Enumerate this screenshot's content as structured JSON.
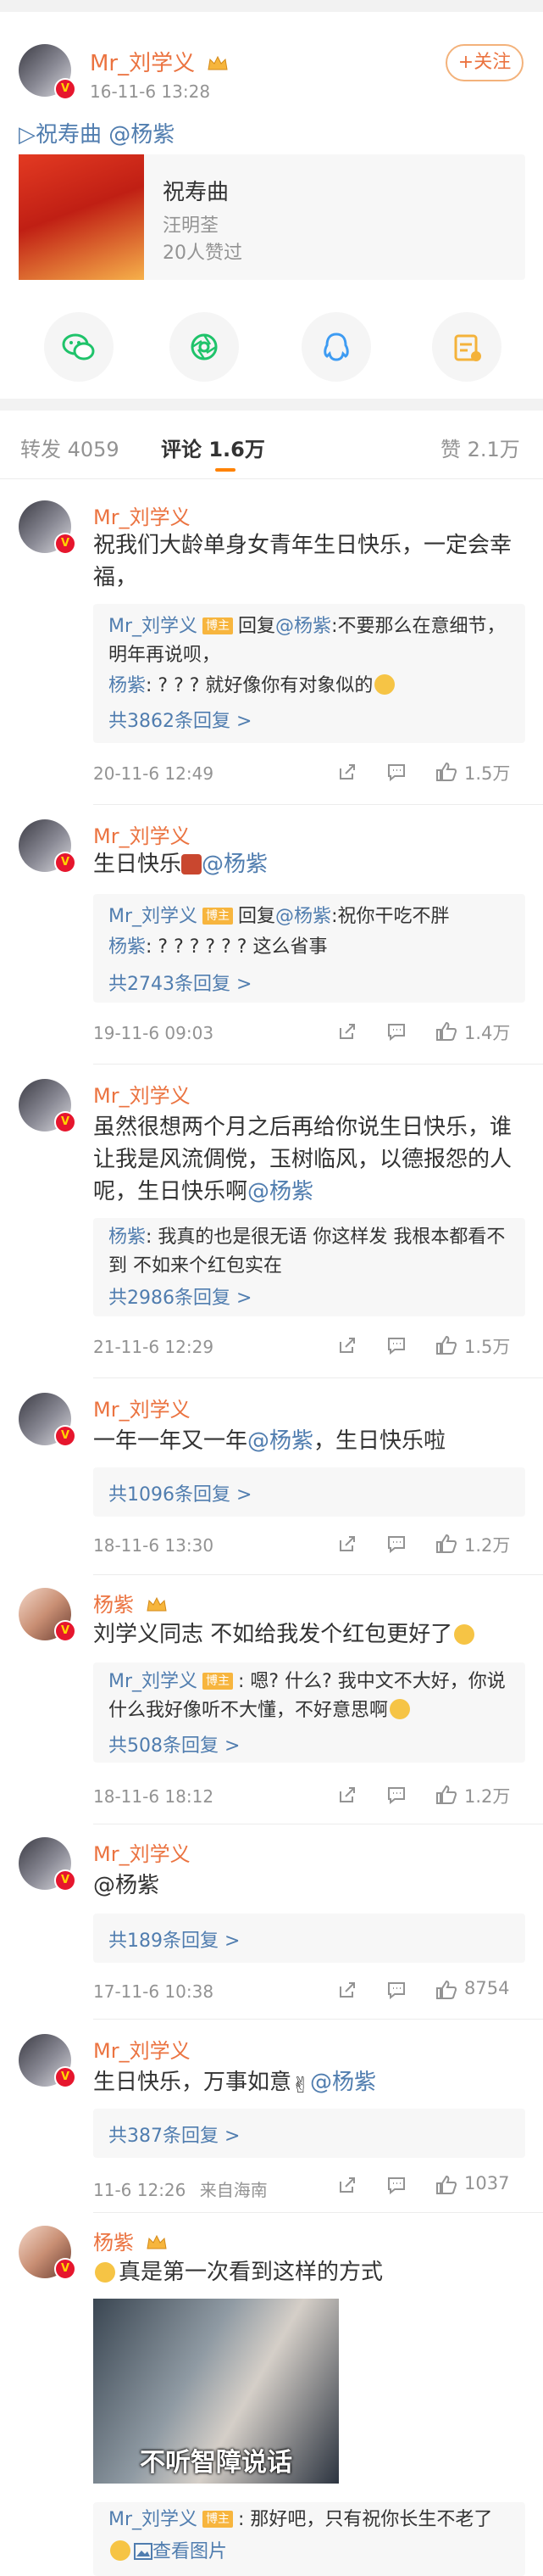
{
  "post": {
    "author": "Mr_刘学义",
    "time": "16-11-6 13:28",
    "follow_label": "+关注",
    "text_prefix": "▷祝寿曲",
    "text_mention": "@杨紫",
    "music": {
      "title": "祝寿曲",
      "artist": "汪明荃",
      "likes": "20人赞过"
    }
  },
  "share_icons": [
    "wechat-icon",
    "moments-icon",
    "qq-icon",
    "qzone-icon"
  ],
  "tabs": {
    "repost": "转发 4059",
    "comment": "评论 1.6万",
    "like": "赞 2.1万"
  },
  "comments": [
    {
      "name": "Mr_刘学义",
      "text": "祝我们大龄单身女青年生日快乐，一定会幸福，",
      "replies": [
        {
          "name": "Mr_刘学义",
          "tag": "博主",
          "verb": "回复",
          "mention": "@杨紫",
          "text": ":不要那么在意细节，明年再说呗，"
        },
        {
          "name": "杨紫",
          "text": ": ? ? ? 就好像你有对象似的"
        }
      ],
      "more": "共3862条回复 >",
      "time": "20-11-6 12:49",
      "likes": "1.5万"
    },
    {
      "name": "Mr_刘学义",
      "text": "生日快乐",
      "mention": "@杨紫",
      "replies": [
        {
          "name": "Mr_刘学义",
          "tag": "博主",
          "verb": "回复",
          "mention": "@杨紫",
          "text": ":祝你干吃不胖"
        },
        {
          "name": "杨紫",
          "text": ": ? ? ? ? ? ? 这么省事"
        }
      ],
      "more": "共2743条回复 >",
      "time": "19-11-6 09:03",
      "likes": "1.4万"
    },
    {
      "name": "Mr_刘学义",
      "text": "虽然很想两个月之后再给你说生日快乐，谁让我是风流倜傥，玉树临风，以德报怨的人呢，生日快乐啊",
      "mention": "@杨紫",
      "replies": [
        {
          "name": "杨紫",
          "text": ": 我真的也是很无语 你这样发 我根本都看不到 不如来个红包实在"
        }
      ],
      "more": "共2986条回复 >",
      "time": "21-11-6 12:29",
      "likes": "1.5万"
    },
    {
      "name": "Mr_刘学义",
      "text": "一年一年又一年",
      "mention": "@杨紫",
      "text_suffix": "，生日快乐啦",
      "more": "共1096条回复 >",
      "time": "18-11-6 13:30",
      "likes": "1.2万"
    },
    {
      "name": "杨紫",
      "text": "刘学义同志 不如给我发个红包更好了",
      "replies": [
        {
          "name": "Mr_刘学义",
          "tag": "博主",
          "text": ": 嗯? 什么? 我中文不大好，你说什么我好像听不大懂，不好意思啊"
        }
      ],
      "more": "共508条回复 >",
      "time": "18-11-6 18:12",
      "likes": "1.2万"
    },
    {
      "name": "Mr_刘学义",
      "mention": "@杨紫",
      "more": "共189条回复 >",
      "time": "17-11-6 10:38",
      "likes": "8754"
    },
    {
      "name": "Mr_刘学义",
      "text": "生日快乐，万事如意",
      "mention": "@杨紫",
      "more": "共387条回复 >",
      "time": "11-6 12:26",
      "location": "来自海南",
      "likes": "1037"
    },
    {
      "name": "杨紫",
      "text": "真是第一次看到这样的方式",
      "image_caption": "不听智障说话",
      "replies": [
        {
          "name": "Mr_刘学义",
          "tag": "博主",
          "text": ": 那好吧，只有祝你长生不老了"
        }
      ],
      "view_image": "查看图片"
    }
  ]
}
